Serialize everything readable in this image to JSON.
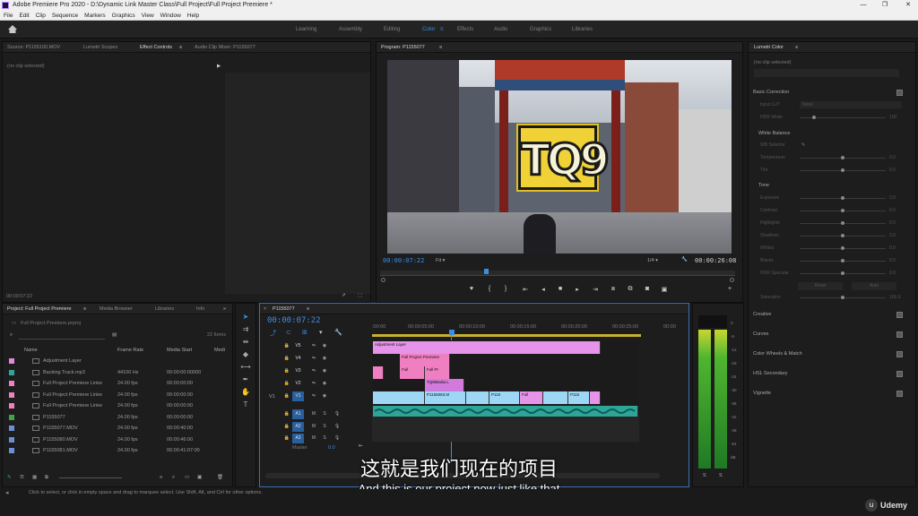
{
  "window": {
    "title": "Adobe Premiere Pro 2020 - D:\\Dynamic Link Master Class\\Full Project\\Full Project Premiere *",
    "minimize": "—",
    "maximize": "❐",
    "close": "✕"
  },
  "menu": [
    "File",
    "Edit",
    "Clip",
    "Sequence",
    "Markers",
    "Graphics",
    "View",
    "Window",
    "Help"
  ],
  "workspaces": [
    "Learning",
    "Assembly",
    "Editing",
    "Color",
    "Effects",
    "Audio",
    "Graphics",
    "Libraries"
  ],
  "source_panel": {
    "tabs": [
      "Source: P1155100.MOV",
      "Lumetri Scopes",
      "Effect Controls",
      "Audio Clip Mixer: P1155077"
    ],
    "no_clip": "(no clip selected)",
    "timecode": "00:00:07:22"
  },
  "program": {
    "tab": "Program: P1155077",
    "timecode": "00:00:07:22",
    "fit": "Fit",
    "quality": "1/4",
    "duration": "00:00:26:08",
    "logo": "TQ9"
  },
  "project": {
    "tabs": [
      "Project: Full Project Premiere",
      "Media Browser",
      "Libraries",
      "Info"
    ],
    "file": "Full Project Premiere.prproj",
    "items_count": "22 Items",
    "columns": [
      "Name",
      "Frame Rate",
      "Media Start",
      "Medi"
    ],
    "rows": [
      {
        "name": "Adjustment Layer",
        "rate": "",
        "start": "",
        "color": "#e08ad8"
      },
      {
        "name": "Backing Track.mp3",
        "rate": "44100 Hz",
        "start": "00:00:00:00000",
        "color": "#2fa59a"
      },
      {
        "name": "Full Project Premiere Linke",
        "rate": "24.00 fps",
        "start": "00:00:00:00",
        "color": "#f07fc1"
      },
      {
        "name": "Full Project Premiere Linke",
        "rate": "24.00 fps",
        "start": "00:00:00:00",
        "color": "#f07fc1"
      },
      {
        "name": "Full Project Premiere Linke",
        "rate": "24.00 fps",
        "start": "00:00:00:00",
        "color": "#f07fc1"
      },
      {
        "name": "P1155077",
        "rate": "24.00 fps",
        "start": "00:00:00:00",
        "color": "#3fa34a"
      },
      {
        "name": "P1155077.MOV",
        "rate": "24.00 fps",
        "start": "00:00:40:00",
        "color": "#6b8fd6"
      },
      {
        "name": "P1155080.MOV",
        "rate": "24.00 fps",
        "start": "00:00:46:00",
        "color": "#6b8fd6"
      },
      {
        "name": "P1155081.MOV",
        "rate": "24.00 fps",
        "start": "00:00:41:07:00",
        "color": "#6b8fd6"
      }
    ]
  },
  "timeline": {
    "tab": "P1155077",
    "timecode": "00:00:07:22",
    "ruler": [
      ":00:00",
      "00:00:05:00",
      "00:00:10:00",
      "00:00:15:00",
      "00:00:20:00",
      "00:00:25:00",
      "00:00"
    ],
    "tracks": [
      "V5",
      "V4",
      "V3",
      "V2",
      "V1",
      "A1",
      "A2",
      "A3"
    ],
    "v1_source": "V1",
    "master": "Master",
    "master_val": "0.0",
    "mute": "M",
    "solo": "S",
    "clips": {
      "adjustment": "Adjustment Layer",
      "fp1": "Full Project Premiere",
      "fp2": "Full",
      "fp3": "Full Pr",
      "tq": "TQ9Media L",
      "v1a": "P1155083.M",
      "v1b": "P115",
      "v1c": "Full",
      "v1d": "P115"
    }
  },
  "meter": {
    "labels": [
      "0",
      "-6",
      "-12",
      "-18",
      "-24",
      "-30",
      "-36",
      "-42",
      "-48",
      "-54",
      "dB"
    ],
    "solo": [
      "S",
      "S"
    ]
  },
  "lumetri": {
    "tab": "Lumetri Color",
    "no_clip": "(no clip selected)",
    "sections": [
      "Basic Correction",
      "Creative",
      "Curves",
      "Color Wheels & Match",
      "HSL Secondary",
      "Vignette"
    ],
    "subsections": [
      "White Balance",
      "Tone"
    ],
    "input_lut": "Input LUT",
    "lut_value": "None",
    "hdr_white": "HDR White",
    "hdr_val": "100",
    "wb": [
      {
        "n": "Temperature",
        "v": "0.0"
      },
      {
        "n": "Tint",
        "v": "0.0"
      }
    ],
    "wb_selector": "WB Selector",
    "tone": [
      {
        "n": "Exposure",
        "v": "0.0"
      },
      {
        "n": "Contrast",
        "v": "0.0"
      },
      {
        "n": "Highlights",
        "v": "0.0"
      },
      {
        "n": "Shadows",
        "v": "0.0"
      },
      {
        "n": "Whites",
        "v": "0.0"
      },
      {
        "n": "Blacks",
        "v": "0.0"
      },
      {
        "n": "HDR Specular",
        "v": "0.0"
      }
    ],
    "reset": "Reset",
    "auto": "Auto",
    "saturation": "Saturation",
    "sat_val": "100.0"
  },
  "subtitle": {
    "zh": "这就是我们现在的项目",
    "en": "And this is our project now just like that"
  },
  "status": "Click to select, or click in empty space and drag to marquee select. Use Shift, Alt, and Ctrl for other options.",
  "watermark": "Udemy"
}
